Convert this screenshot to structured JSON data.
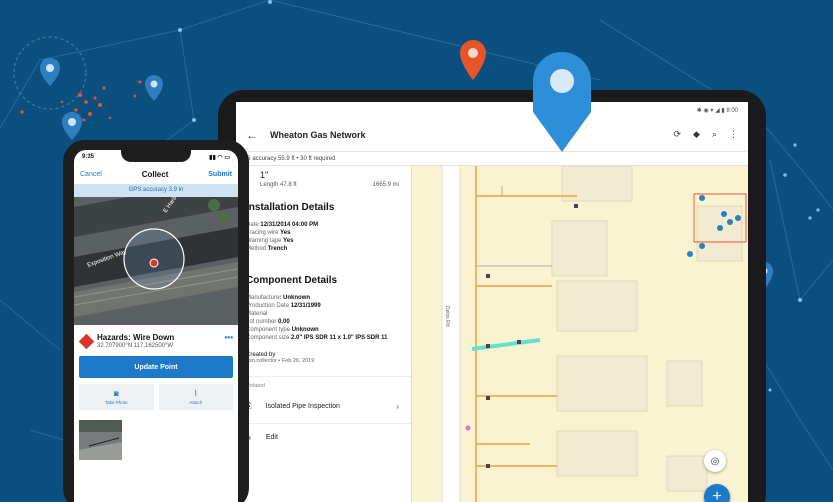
{
  "tablet": {
    "status_icons": "✱ ◉ ▾ ◢ ▮ 8:00",
    "title": "Wheaton Gas Network",
    "gps_text": "GPS accuracy 55.9 ft  •  30 ft required",
    "feature_head": "1\"",
    "length_label": "Length 47.8 ft",
    "length_side": "1665.9 mi",
    "installation_title": "Installation Details",
    "install": {
      "date_label": "Date",
      "date_value": "12/31/2014 04:00 PM",
      "tracing_label": "Tracing wire",
      "tracing_value": "Yes",
      "warning_label": "Warning tape",
      "warning_value": "Yes",
      "method_label": "Method",
      "method_value": "Trench"
    },
    "component_title": "Component Details",
    "component": {
      "manufacturer_label": "Manufacturer",
      "manufacturer_value": "Unknown",
      "production_label": "Production Date",
      "production_value": "12/31/1999",
      "material_label": "Material",
      "lot_label": "Lot number",
      "lot_value": "0.00",
      "type_label": "Component type",
      "type_value": "Unknown",
      "size_label": "Component size",
      "size_value": "2.0\" IPS SDR 11 x 1.0\" IPS SDR 11"
    },
    "created_by": "Created by",
    "created_sub": "gsn.collector • Feb 26, 2019",
    "related": "Related",
    "related_item": "Isolated Pipe Inspection",
    "edit_label": "Edit",
    "road_label": "Delos Rd"
  },
  "phone": {
    "time": "9:35",
    "status_icons": "▮▮ ◠ ▭",
    "cancel": "Cancel",
    "title": "Collect",
    "submit": "Submit",
    "gps": "GPS accuracy 3.9 in",
    "street_a": "E Harbor Dr",
    "street_b": "Exposition Way",
    "hazard_title": "Hazards: Wire Down",
    "hazard_coord": "32.707900°N  117.162500°W",
    "more": "•••",
    "update_button": "Update Point",
    "take_photo": "Take Photo",
    "attach": "Attach"
  },
  "colors": {
    "background": "#0b4f7e",
    "accent": "#1c7ac8",
    "pin_blue": "#2e7fc0",
    "pin_orange": "#e8542a",
    "hazard": "#d9352b"
  }
}
